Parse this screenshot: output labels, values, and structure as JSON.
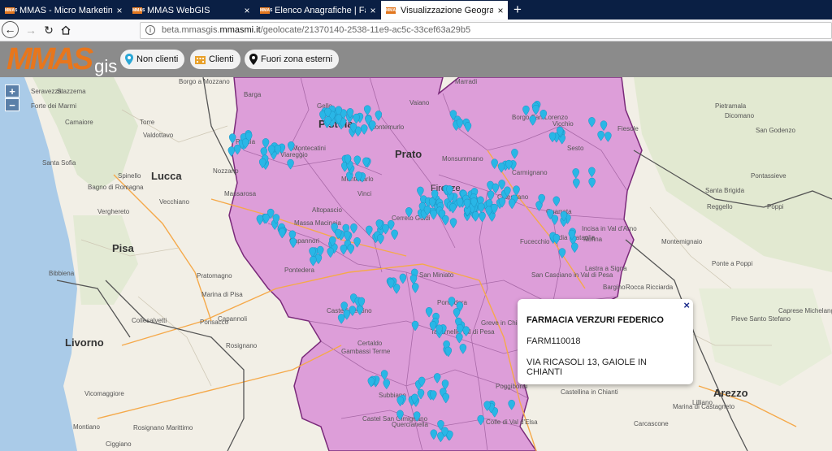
{
  "browser": {
    "tabs": [
      {
        "label": "MMAS - Micro Marketing Anal",
        "close": "×"
      },
      {
        "label": "MMAS WebGIS",
        "close": "×"
      },
      {
        "label": "Elenco Anagrafiche | Farmacie",
        "close": "×"
      },
      {
        "label": "Visualizzazione Geografica",
        "close": "×"
      }
    ],
    "new_tab": "+",
    "url_prefix": "beta.mmasgis.",
    "url_host": "mmasmi.it",
    "url_path": "/geolocate/21370140-2538-11e9-ac5c-33cef63a29b5"
  },
  "app": {
    "logo_text": "MMAS",
    "logo_suffix": "gis",
    "buttons": {
      "non_clienti": "Non clienti",
      "clienti": "Clienti",
      "fuori_zona": "Fuori zona esterni"
    }
  },
  "map": {
    "zoom_in": "+",
    "zoom_out": "−",
    "region_color": "#d98fd6",
    "marker_color": "#29b6e6",
    "cities": {
      "prato": "Prato",
      "lucca": "Lucca",
      "pisa": "Pisa",
      "livorno": "Livorno",
      "arezzo": "Arezzo",
      "pistoia": "Pistoia",
      "firenze": "Firenze"
    },
    "places": [
      "Seravezza",
      "Stazzema",
      "Borgo a Mozzano",
      "Barga",
      "Borgo San Lorenzo",
      "Marradi",
      "Forte dei Marmi",
      "Gello",
      "Vaiano",
      "Camaiore",
      "Pescia",
      "Montemurlo",
      "Vicchio",
      "Pietramala",
      "Torre",
      "Valdottavo",
      "Montecatini",
      "Sesto",
      "Dicomano",
      "Santa Sofia",
      "Viareggio",
      "Monsummano",
      "Calenzano",
      "Fiesole",
      "San Godenzo",
      "Spinello",
      "Nozzano",
      "Montecarlo",
      "Quarrata",
      "Pontassieve",
      "Bagno di Romagna",
      "Massarosa",
      "Altopascio",
      "Vinci",
      "Carmignano",
      "Santa Brigida",
      "Poppi",
      "Verghereto",
      "Vecchiano",
      "Massa Macinaia",
      "Cerreto Guidi",
      "Lastra a Signa",
      "Reggello",
      "Badia Prataglia",
      "Capannori",
      "Fucecchio",
      "Rufina",
      "Pratomagno",
      "Pontedera",
      "San Miniato",
      "San Casciano in Val di Pesa",
      "Incisa in Val d'Arno",
      "Montemignaio",
      "Ponte a Poppi",
      "Bibbiena",
      "Marina di Pisa",
      "Pontedera",
      "Bargino",
      "Rocca Ricciarda",
      "Caprese Michelangelo",
      "Ponsacco",
      "Castelfiorentino",
      "Greve in Chianti",
      "Pieve Santo Stefano",
      "Collesalvetti",
      "Capannoli",
      "Tavarnelle Val di Pesa",
      "Certaldo",
      "Gambassi Terme",
      "Rosignano",
      "Poggibonsi",
      "Castellina in Chianti",
      "Subbiano",
      "Colle di Val d'Elsa",
      "Lilliano",
      "Vicomaggiore",
      "Quercianella",
      "Castel San Gimignano",
      "Rosignano Marittimo",
      "Montiano",
      "Carcascone",
      "Marina di Castagneto",
      "Ciggiano"
    ],
    "popup": {
      "name": "FARMACIA VERZURI FEDERICO",
      "code": "FARM110018",
      "address": "VIA RICASOLI 13, GAIOLE IN CHIANTI",
      "close": "×"
    }
  }
}
